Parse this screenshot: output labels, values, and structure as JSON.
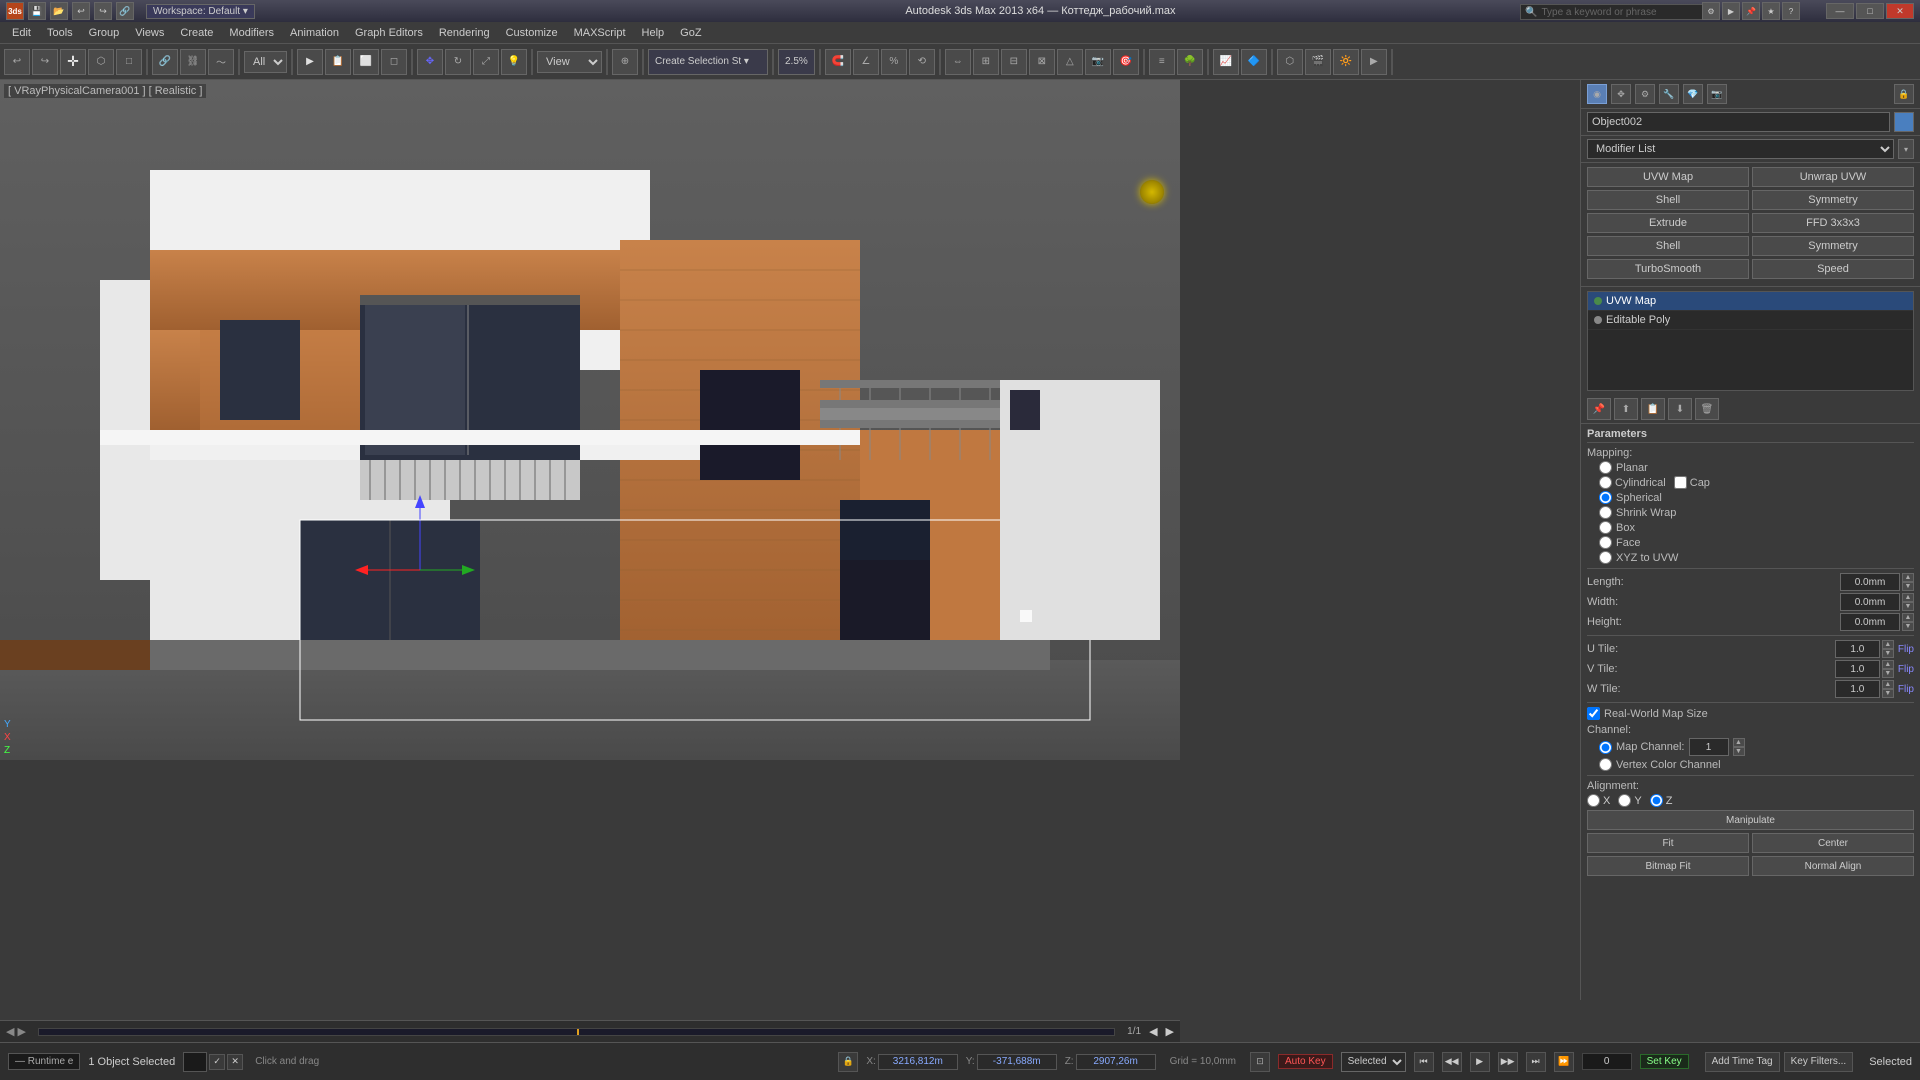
{
  "titleBar": {
    "title": "Autodesk 3ds Max 2013 x64 — Коттедж_рабочий.max",
    "search_placeholder": "Type a keyword or phrase",
    "minimize": "—",
    "maximize": "□",
    "close": "✕"
  },
  "menuBar": {
    "items": [
      "Edit",
      "Tools",
      "Group",
      "Views",
      "Create",
      "Modifiers",
      "Animation",
      "Graph Editors",
      "Rendering",
      "Customize",
      "MAXScript",
      "Help",
      "GoZ"
    ]
  },
  "toolbar": {
    "undo_label": "⟲",
    "redo_label": "⟳",
    "select_label": "▶",
    "move_label": "✥",
    "rotate_label": "↻",
    "scale_label": "⤢",
    "dropdown_view": "View",
    "create_selection_label": "Create Selection St",
    "percent_label": "2.5"
  },
  "viewport": {
    "label": "[ VRayPhysicalCamera001 ] [ Realistic ]"
  },
  "rightPanel": {
    "objectName": "Object002",
    "colorSwatchLabel": "■",
    "modifierListLabel": "Modifier List",
    "modifierRows": [
      [
        "UVW Map",
        "Unwrap UVW"
      ],
      [
        "Shell",
        "Symmetry"
      ],
      [
        "Extrude",
        "FFD 3x3x3"
      ],
      [
        "Shell",
        "Symmetry"
      ],
      [
        "TurboSmooth",
        "Speed"
      ]
    ],
    "stack": [
      {
        "name": "UVW Map",
        "active": true
      },
      {
        "name": "Editable Poly",
        "active": false
      }
    ],
    "parameters": {
      "title": "Parameters",
      "mapping_label": "Mapping:",
      "mapping_options": [
        "Planar",
        "Cylindrical",
        "Cap",
        "Spherical",
        "Shrink Wrap",
        "Box",
        "Face",
        "XYZ to UVW"
      ],
      "selected_mapping": "Spherical",
      "length_label": "Length:",
      "length_value": "0.0mm",
      "width_label": "Width:",
      "width_value": "0.0mm",
      "height_label": "Height:",
      "height_value": "0.0mm",
      "u_tile_label": "U Tile:",
      "u_tile_value": "1.0",
      "v_tile_label": "V Tile:",
      "v_tile_value": "1.0",
      "w_tile_label": "W Tile:",
      "w_tile_value": "1.0",
      "flip_label": "Flip",
      "realworld_label": "Real-World Map Size",
      "channel_label": "Channel:",
      "map_channel_label": "Map Channel:",
      "map_channel_value": "1",
      "vertex_color_label": "Vertex Color Channel",
      "alignment_label": "Alignment:",
      "align_x": "X",
      "align_y": "Y",
      "align_z": "Z",
      "manipulate_label": "Manipulate",
      "fit_label": "Fit",
      "center_label": "Center",
      "bitmap_fit_label": "Bitmap Fit",
      "normal_align_label": "Normal Align"
    }
  },
  "statusBar": {
    "selected_count": "1 Object Selected",
    "hint": "Click and drag",
    "coords": {
      "x_label": "X:",
      "x_value": "3216,812m",
      "y_label": "Y:",
      "y_value": "-371,688m",
      "z_label": "Z:",
      "z_value": "2907,26m",
      "grid_label": "Grid = 10,0mm"
    },
    "auto_key_label": "Auto Key",
    "selected_dropdown": "Selected",
    "set_key_label": "Set Key",
    "key_filters_label": "Key Filters...",
    "add_time_tag_label": "Add Time Tag",
    "frame_counter": "1 / 1"
  },
  "icons": {
    "search": "🔍",
    "eye": "👁",
    "gear": "⚙",
    "lock": "🔒",
    "pin": "📌",
    "move_up": "▲",
    "move_down": "▼",
    "play": "▶",
    "stop": "■",
    "prev": "⏮",
    "next": "⏭",
    "prev_frame": "◀",
    "next_frame": "▶",
    "key": "🔑",
    "stack_pin": "📌",
    "stack_trash": "🗑",
    "stack_up": "⬆",
    "stack_down": "⬇",
    "stack_copy": "📋"
  }
}
